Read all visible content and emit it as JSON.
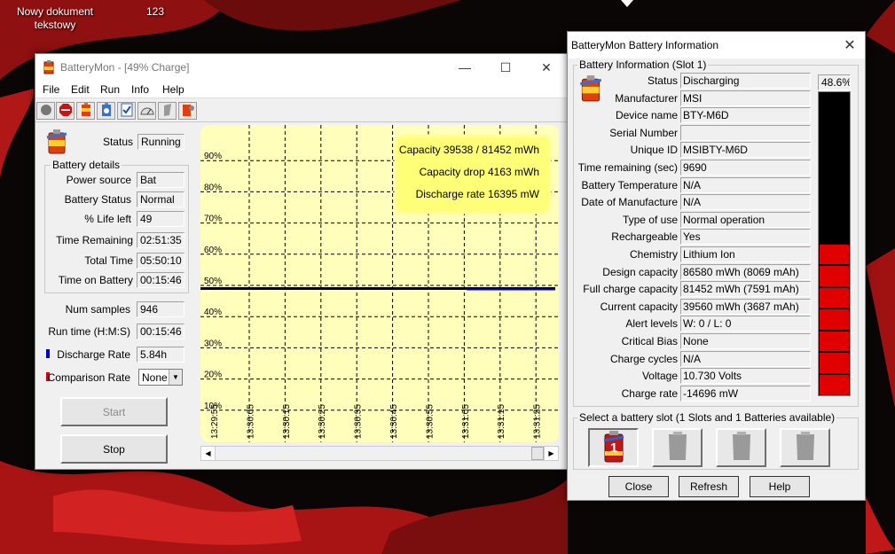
{
  "desktop": {
    "icon_label": "Nowy dokument tekstowy",
    "icon_label_line1": "Nowy dokument",
    "icon_label_line2": "tekstowy",
    "counter": "123"
  },
  "main_window": {
    "title": "BatteryMon - [49% Charge]",
    "menu": [
      "File",
      "Edit",
      "Run",
      "Info",
      "Help"
    ],
    "toolbar_icons": [
      "record-icon",
      "stop-icon",
      "battery-icon",
      "info-icon",
      "checklist-icon",
      "gauge-icon",
      "flag-icon",
      "battery-settings-icon"
    ],
    "status_label": "Status",
    "status_value": "Running",
    "battery_details_title": "Battery details",
    "details": [
      {
        "label": "Power source",
        "value": "Bat"
      },
      {
        "label": "Battery Status",
        "value": "Normal"
      },
      {
        "label": "% Life left",
        "value": "49"
      },
      {
        "label": "Time Remaining",
        "value": "02:51:35"
      },
      {
        "label": "Total Time",
        "value": "05:50:10"
      },
      {
        "label": "Time on Battery",
        "value": "00:15:46"
      }
    ],
    "num_samples_label": "Num samples",
    "num_samples_value": "946",
    "run_time_label": "Run time (H:M:S)",
    "run_time_value": "00:15:46",
    "discharge_rate_label": "Discharge Rate",
    "discharge_rate_value": "5.84h",
    "comparison_rate_label": "Comparison Rate",
    "comparison_rate_value": "None",
    "start_label": "Start",
    "stop_label": "Stop",
    "colors": {
      "discharge": "#0000cc",
      "comparison": "#dd0000",
      "graph_bg": "#ffffbb"
    }
  },
  "graph": {
    "y_ticks": [
      "90%",
      "80%",
      "70%",
      "60%",
      "50%",
      "40%",
      "30%",
      "20%",
      "10%"
    ],
    "x_ticks": [
      "13:29:55",
      "13:30:05",
      "13:30:15",
      "13:30:25",
      "13:30:35",
      "13:30:45",
      "13:30:55",
      "13:31:05",
      "13:31:15",
      "13:31:25"
    ],
    "charge_level": 49,
    "info_lines": [
      "Capacity 39538 / 81452 mWh",
      "Capacity drop 4163 mWh",
      "Discharge rate 16395 mW"
    ]
  },
  "info_window": {
    "title": "BatteryMon Battery Information",
    "group_title": "Battery Information (Slot 1)",
    "rows": [
      {
        "label": "Status",
        "value": "Discharging"
      },
      {
        "label": "Manufacturer",
        "value": "MSI"
      },
      {
        "label": "Device name",
        "value": "BTY-M6D"
      },
      {
        "label": "Serial Number",
        "value": ""
      },
      {
        "label": "Unique ID",
        "value": "MSIBTY-M6D"
      },
      {
        "label": "Time remaining (sec)",
        "value": "9690"
      },
      {
        "label": "Battery Temperature",
        "value": "N/A"
      },
      {
        "label": "Date of Manufacture",
        "value": "N/A"
      },
      {
        "label": "Type of use",
        "value": "Normal operation"
      },
      {
        "label": "Rechargeable",
        "value": "Yes"
      },
      {
        "label": "Chemistry",
        "value": "Lithium Ion"
      },
      {
        "label": "Design capacity",
        "value": "86580 mWh (8069 mAh)"
      },
      {
        "label": "Full charge capacity",
        "value": "81452 mWh (7591 mAh)"
      },
      {
        "label": "Current capacity",
        "value": "39560 mWh (3687 mAh)"
      },
      {
        "label": "Alert levels",
        "value": "W: 0 / L: 0"
      },
      {
        "label": "Critical Bias",
        "value": "None"
      },
      {
        "label": "Charge cycles",
        "value": "N/A"
      },
      {
        "label": "Voltage",
        "value": "10.730 Volts"
      },
      {
        "label": "Charge rate",
        "value": "-14696 mW"
      }
    ],
    "percent_label": "48.6%",
    "percent_value": 48.6,
    "slot_group_title": "Select a battery slot (1 Slots and 1 Batteries available)",
    "slot_1_label": "1",
    "close_label": "Close",
    "refresh_label": "Refresh",
    "help_label": "Help",
    "colors": {
      "meter_fill": "#e00000",
      "meter_bg": "#000000"
    }
  }
}
